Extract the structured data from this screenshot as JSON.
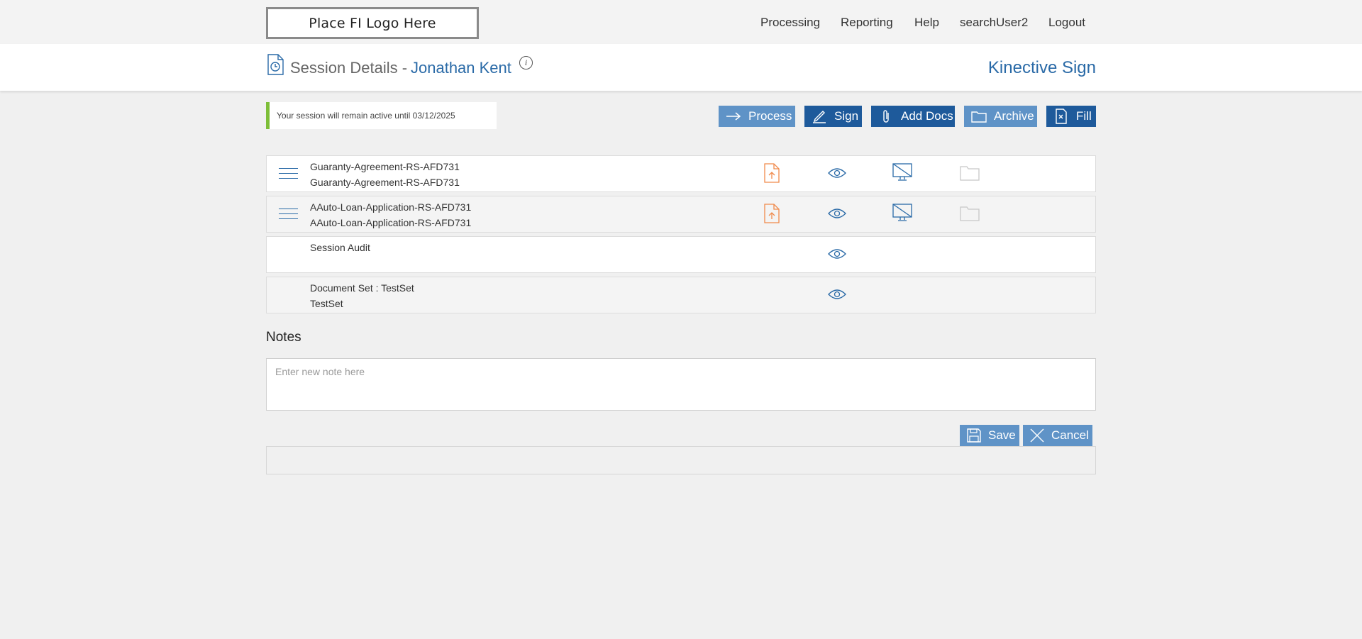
{
  "topnav": {
    "logo": "Place FI Logo Here",
    "items": [
      "Processing",
      "Reporting",
      "Help",
      "searchUser2",
      "Logout"
    ]
  },
  "header": {
    "title": "Session Details -",
    "customer": "Jonathan Kent",
    "info_icon": "i",
    "brand": "Kinective Sign"
  },
  "notice": "Your session will remain active until 03/12/2025",
  "actions": {
    "process": "Process",
    "sign": "Sign",
    "add_docs": "Add Docs",
    "archive": "Archive",
    "fill": "Fill"
  },
  "documents": [
    {
      "line1": "Guaranty-Agreement-RS-AFD731",
      "line2": "Guaranty-Agreement-RS-AFD731"
    },
    {
      "line1": "AAuto-Loan-Application-RS-AFD731",
      "line2": "AAuto-Loan-Application-RS-AFD731"
    },
    {
      "line1": "Session Audit",
      "line2": ""
    },
    {
      "line1": "Document Set : TestSet",
      "line2": "TestSet"
    }
  ],
  "notes": {
    "label": "Notes",
    "placeholder": "Enter new note here",
    "save": "Save",
    "cancel": "Cancel"
  },
  "colors": {
    "accent_blue": "#2a6aa7",
    "button_light": "#5f93c7",
    "button_dark": "#1e5a9b",
    "upload_orange": "#f08a4b",
    "notice_green": "#7dbe38"
  },
  "icons": {
    "header": "session-history-icon",
    "menu": "hamburger-icon",
    "upload": "upload-document-icon",
    "view": "eye-icon",
    "no_screen": "screen-disabled-icon",
    "folder": "folder-icon"
  }
}
